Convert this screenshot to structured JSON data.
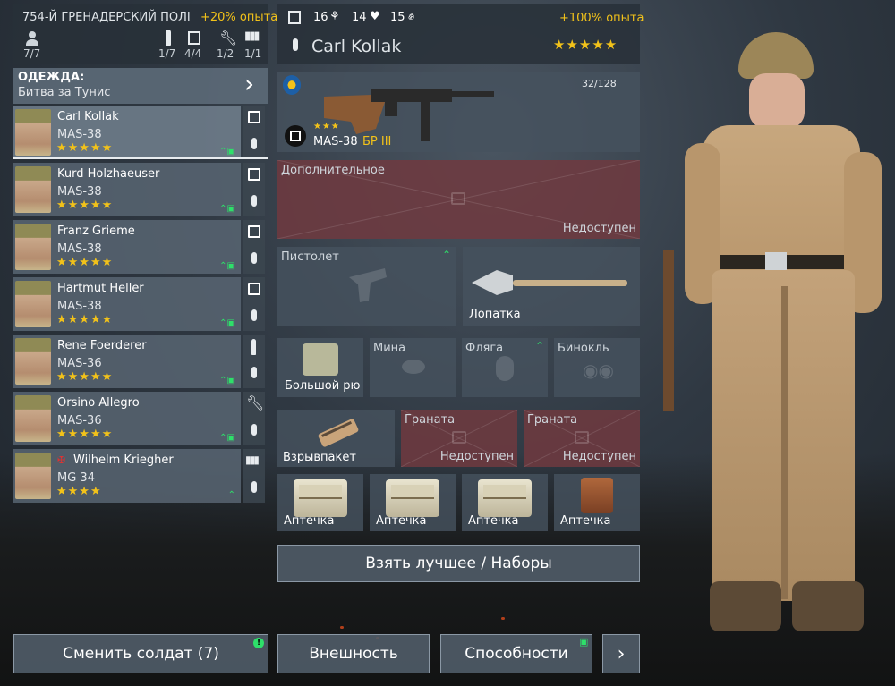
{
  "squad": {
    "name": "754-Й ГРЕНАДЕРСКИЙ ПОЛІ",
    "xp_bonus": "+20% опыта",
    "count": "7/7",
    "stats": [
      "1/7",
      "4/4",
      "1/2",
      "1/1"
    ]
  },
  "clothing": {
    "label": "ОДЕЖДА:",
    "value": "Битва за Тунис"
  },
  "soldiers": [
    {
      "name": "Carl Kollak",
      "weapon": "MAS-38",
      "stars": "★★★★★"
    },
    {
      "name": "Kurd Holzhaeuser",
      "weapon": "MAS-38",
      "stars": "★★★★★"
    },
    {
      "name": "Franz Grieme",
      "weapon": "MAS-38",
      "stars": "★★★★★"
    },
    {
      "name": "Hartmut Heller",
      "weapon": "MAS-38",
      "stars": "★★★★★"
    },
    {
      "name": "Rene Foerderer",
      "weapon": "MAS-36",
      "stars": "★★★★★"
    },
    {
      "name": "Orsino Allegro",
      "weapon": "MAS-36",
      "stars": "★★★★★"
    },
    {
      "name": "Wilhelm Kriegher",
      "weapon": "MG 34",
      "stars": "★★★★"
    }
  ],
  "header": {
    "stat1": "16",
    "stat2": "14",
    "stat3": "15",
    "xp": "+100% опыта",
    "soldier_name": "Carl Kollak",
    "stars": "★★★★★"
  },
  "primary": {
    "ammo": "32/128",
    "weapon": "MAS-38",
    "tier": "БР III",
    "stars": "★★★"
  },
  "slots": {
    "extra": "Дополнительное",
    "unavailable": "Недоступен",
    "pistol": "Пистолет",
    "shovel": "Лопатка",
    "backpack": "Большой рю",
    "mine": "Мина",
    "flask": "Фляга",
    "binocular": "Бинокль",
    "explosive": "Взрывпакет",
    "grenade": "Граната",
    "medkit": "Аптечка"
  },
  "buttons": {
    "best": "Взять лучшее / Наборы",
    "change": "Сменить солдат (7)",
    "appearance": "Внешность",
    "abilities": "Способности",
    "next": "›"
  },
  "colors": {
    "accent": "#f2c21a",
    "green": "#2ee06a",
    "locked": "#703a40"
  }
}
